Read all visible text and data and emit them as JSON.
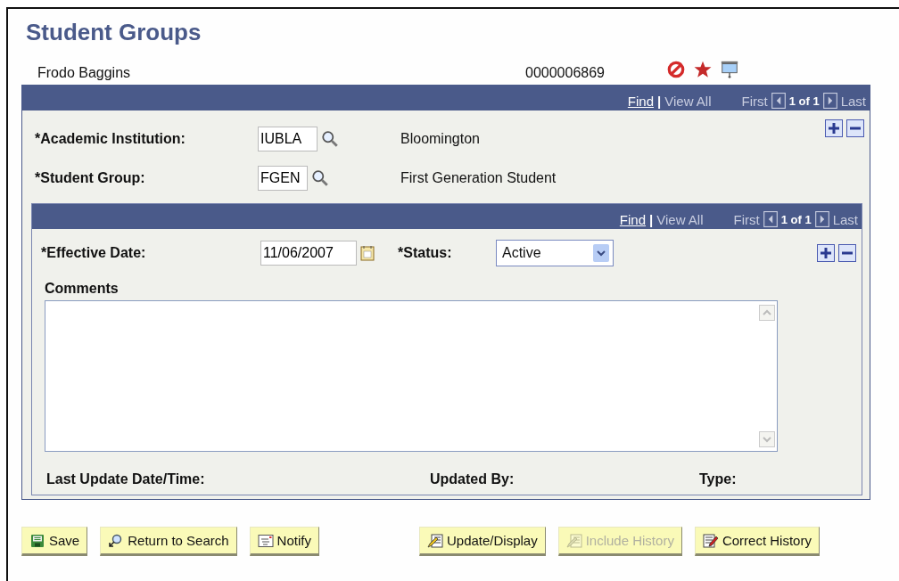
{
  "page": {
    "title": "Student Groups",
    "student_name": "Frodo Baggins",
    "student_id": "0000006869"
  },
  "outer_grid": {
    "find": "Find",
    "separator": "|",
    "view_all": "View All",
    "first": "First",
    "count": "1 of 1",
    "last": "Last",
    "fields": [
      {
        "label": "*Academic Institution:",
        "value": "IUBLA",
        "description": "Bloomington"
      },
      {
        "label": "*Student Group:",
        "value": "FGEN",
        "description": "First Generation Student"
      }
    ]
  },
  "inner_grid": {
    "find": "Find",
    "separator": "|",
    "view_all": "View All",
    "first": "First",
    "count": "1 of 1",
    "last": "Last",
    "effective_date": {
      "label": "*Effective Date:",
      "value": "11/06/2007"
    },
    "status": {
      "label": "*Status:",
      "value": "Active"
    },
    "comments": {
      "label": "Comments"
    },
    "footer": [
      "Last Update Date/Time:",
      "Updated By:",
      "Type:"
    ]
  },
  "buttons": [
    {
      "label": "Save",
      "kind": "save",
      "disabled": false
    },
    {
      "label": "Return to Search",
      "kind": "search",
      "disabled": false
    },
    {
      "label": "Notify",
      "kind": "notify",
      "disabled": false
    },
    {
      "label": "Update/Display",
      "kind": "update",
      "disabled": false
    },
    {
      "label": "Include History",
      "kind": "include",
      "disabled": true
    },
    {
      "label": "Correct History",
      "kind": "correct",
      "disabled": false
    }
  ]
}
